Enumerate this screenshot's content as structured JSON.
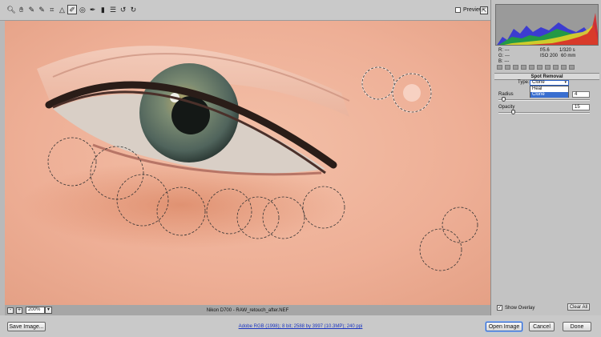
{
  "toolbar": {
    "tools": [
      {
        "name": "zoom-tool",
        "icon": "magnifier-icon",
        "glyph": "🔍︎"
      },
      {
        "name": "hand-tool",
        "icon": "hand-icon",
        "glyph": "✋︎"
      },
      {
        "name": "white-balance-tool",
        "icon": "eyedropper-icon",
        "glyph": "✎"
      },
      {
        "name": "color-sampler-tool",
        "icon": "sampler-icon",
        "glyph": "✎"
      },
      {
        "name": "crop-tool",
        "icon": "crop-icon",
        "glyph": "⌗"
      },
      {
        "name": "straighten-tool",
        "icon": "straighten-icon",
        "glyph": "△"
      },
      {
        "name": "spot-removal-tool",
        "icon": "spot-removal-icon",
        "glyph": "✐"
      },
      {
        "name": "red-eye-tool",
        "icon": "red-eye-icon",
        "glyph": "◎"
      },
      {
        "name": "adjustment-brush-tool",
        "icon": "brush-icon",
        "glyph": "✒"
      },
      {
        "name": "graduated-filter-tool",
        "icon": "graduated-filter-icon",
        "glyph": "▮"
      },
      {
        "name": "preferences-tool",
        "icon": "list-icon",
        "glyph": "☰"
      },
      {
        "name": "rotate-left-tool",
        "icon": "rotate-ccw-icon",
        "glyph": "↺"
      },
      {
        "name": "rotate-right-tool",
        "icon": "rotate-cw-icon",
        "glyph": "↻"
      }
    ],
    "active_tool": "spot-removal-tool",
    "preview_label": "Preview",
    "preview_checked": false
  },
  "status": {
    "zoom_value": "200%",
    "filename": "Nikon D700  -  RAW_retouch_after.NEF"
  },
  "readout": {
    "r": "R:   ---",
    "g": "G:   ---",
    "b": "B:   ---",
    "aperture": "f/5.6",
    "shutter": "1/320 s",
    "iso": "ISO 200",
    "focal": "60 mm"
  },
  "panel": {
    "section_title": "Spot Removal",
    "type_label": "Type:",
    "type_value": "Clone",
    "type_options": [
      "Heal",
      "Clone"
    ],
    "radius_label": "Radius",
    "radius_value": "4",
    "radius_fraction": 0.04,
    "opacity_label": "Opacity",
    "opacity_value": "15",
    "opacity_fraction": 0.15,
    "show_overlay_label": "Show Overlay",
    "show_overlay_checked": true,
    "clear_all_label": "Clear All"
  },
  "bottom": {
    "save_image_label": "Save Image...",
    "workflow_text": "Adobe RGB (1998); 8 bit; 2588 by 3997 (10.3MP); 240 ppi",
    "open_image_label": "Open Image",
    "cancel_label": "Cancel",
    "done_label": "Done"
  },
  "colors": {
    "accent": "#2d63c8",
    "skin": "#e8a48b",
    "iris": "#6e7f6a"
  }
}
